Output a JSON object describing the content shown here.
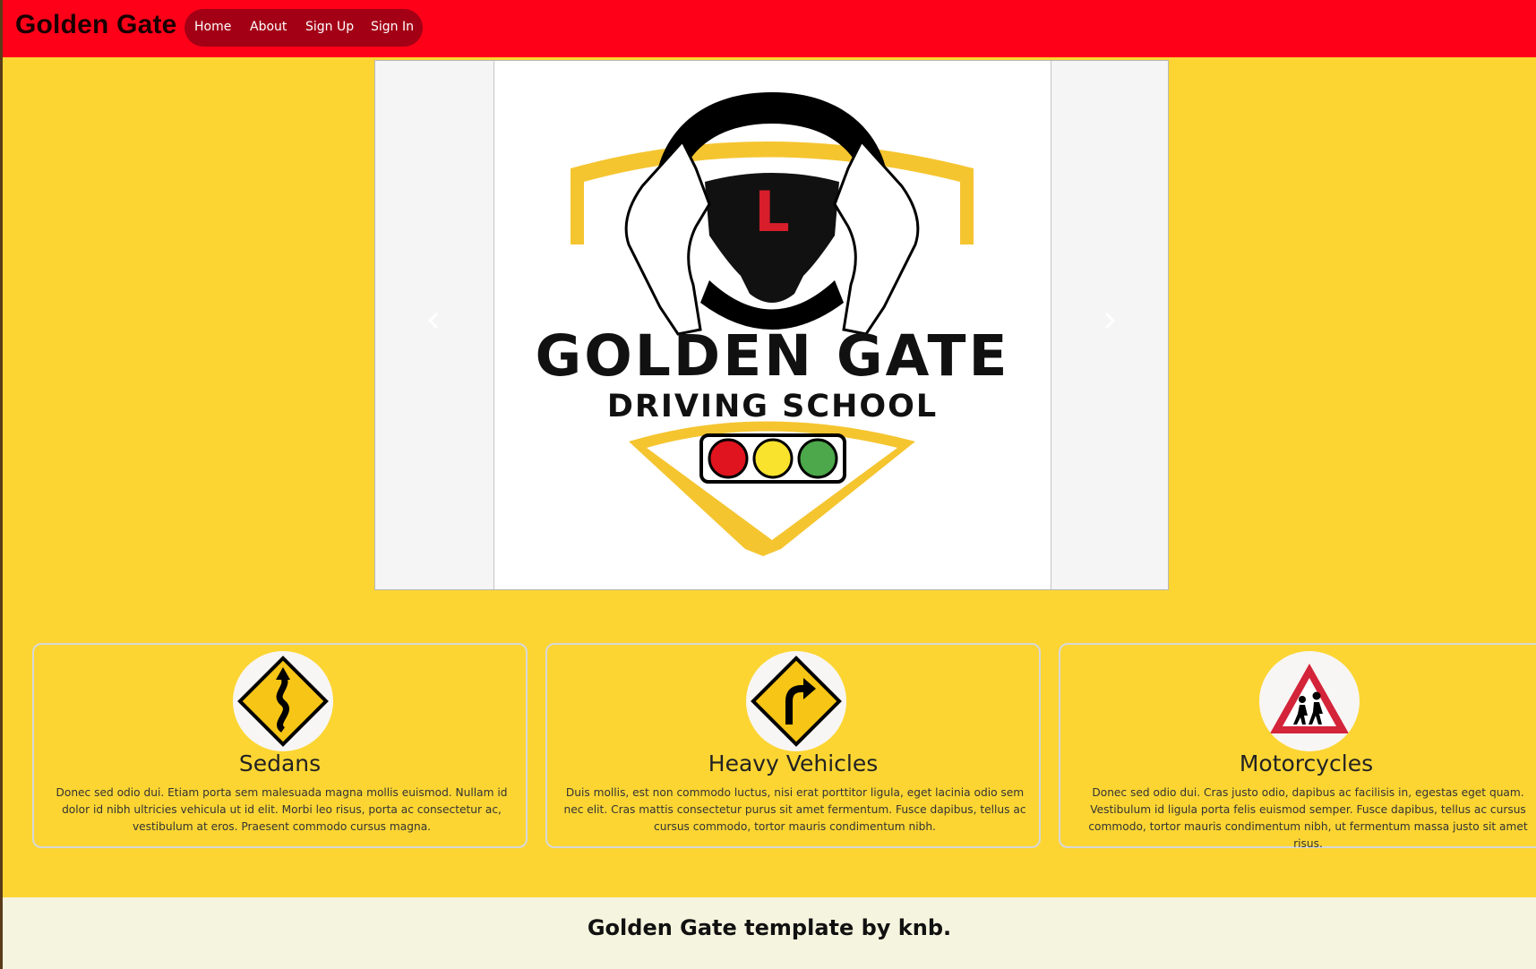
{
  "navbar": {
    "brand": "Golden Gate",
    "links": [
      "Home",
      "About",
      "Sign Up",
      "Sign In"
    ]
  },
  "carousel": {
    "logo_title": "GOLDEN GATE",
    "logo_subtitle": "DRIVING SCHOOL",
    "logo_letter": "L",
    "prev_icon": "chevron-left-icon",
    "next_icon": "chevron-right-icon"
  },
  "cards": [
    {
      "title": "Sedans",
      "icon": "winding-road-sign-icon",
      "text": "Donec sed odio dui. Etiam porta sem malesuada magna mollis euismod. Nullam id dolor id nibh ultricies vehicula ut id elit. Morbi leo risus, porta ac consectetur ac, vestibulum at eros. Praesent commodo cursus magna."
    },
    {
      "title": "Heavy Vehicles",
      "icon": "right-turn-sign-icon",
      "text": "Duis mollis, est non commodo luctus, nisi erat porttitor ligula, eget lacinia odio sem nec elit. Cras mattis consectetur purus sit amet fermentum. Fusce dapibus, tellus ac cursus commodo, tortor mauris condimentum nibh."
    },
    {
      "title": "Motorcycles",
      "icon": "children-crossing-sign-icon",
      "text": "Donec sed odio dui. Cras justo odio, dapibus ac facilisis in, egestas eget quam. Vestibulum id ligula porta felis euismod semper. Fusce dapibus, tellus ac cursus commodo, tortor mauris condimentum nibh, ut fermentum massa justo sit amet risus."
    }
  ],
  "footer": {
    "text": "Golden Gate template by knb."
  },
  "colors": {
    "navbar": "#ff0019",
    "nav_pill": "#a30016",
    "page_background": "#fcd533",
    "footer": "#f5f4de",
    "traffic_red": "#e0141e",
    "traffic_yellow": "#fae32d",
    "traffic_green": "#4ca84a"
  }
}
